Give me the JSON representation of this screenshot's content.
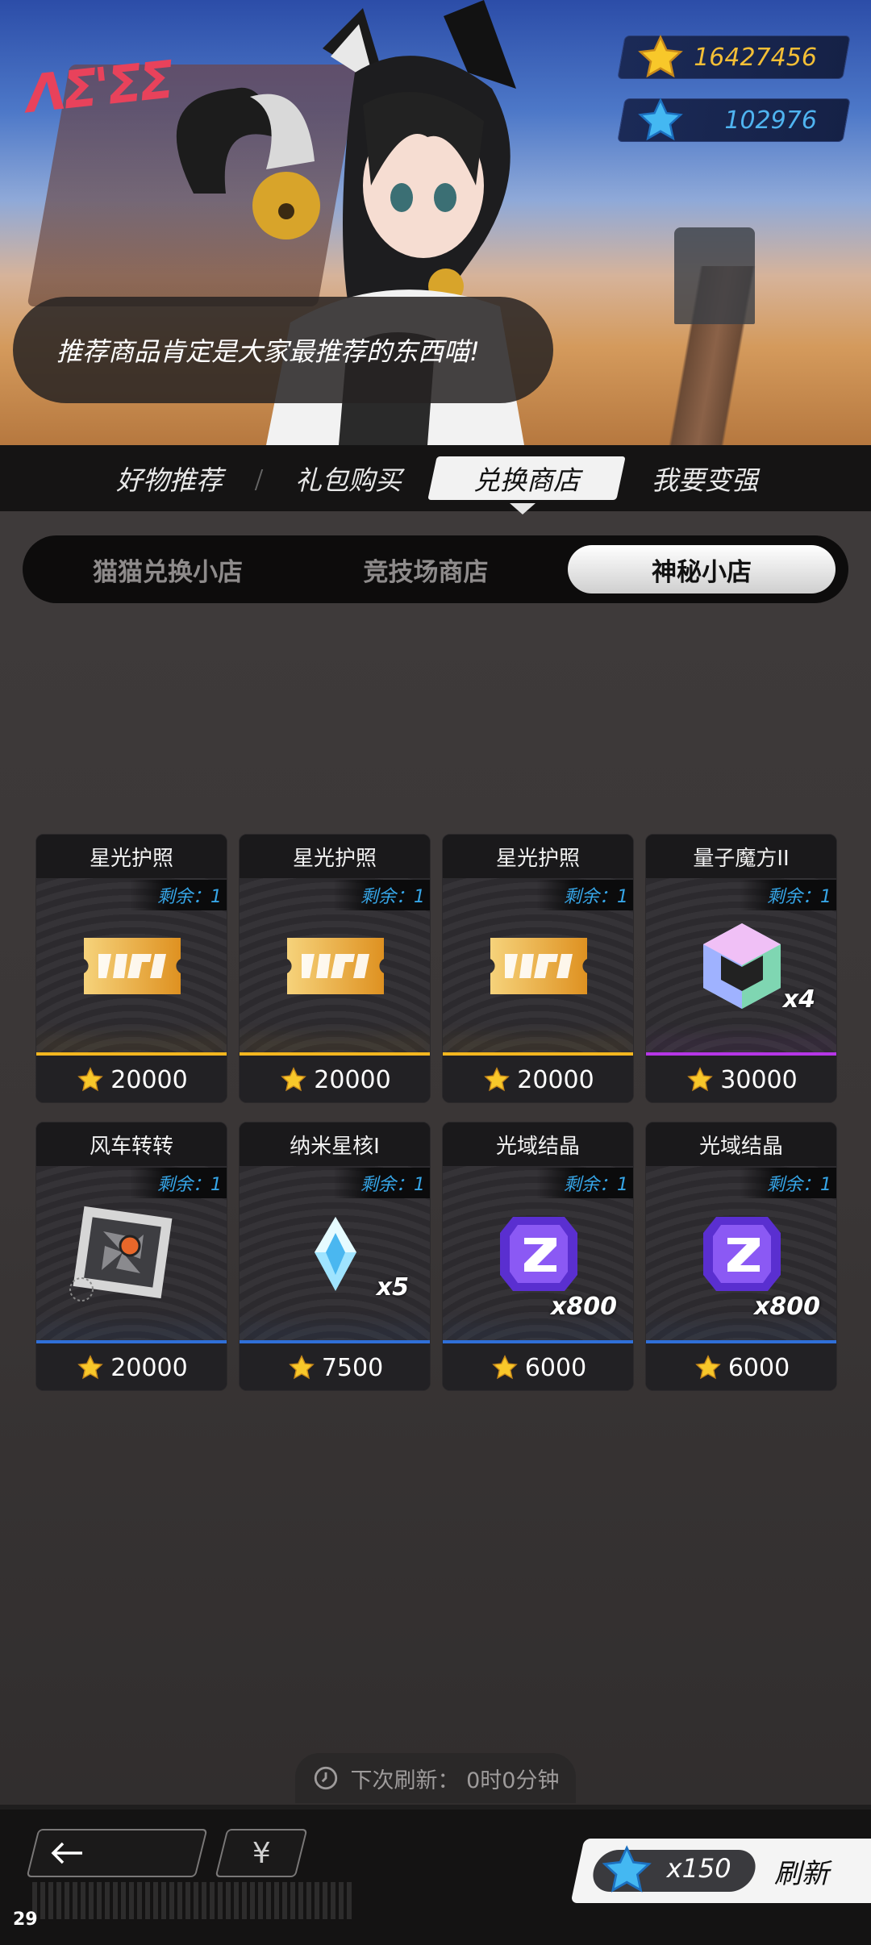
{
  "currency": {
    "gold_value": "16427456",
    "blue_value": "102976",
    "gold_icon": "gold-star-icon",
    "blue_icon": "blue-star-icon"
  },
  "speech": "推荐商品肯定是大家最推荐的东西喵!",
  "tabs": [
    {
      "label": "好物推荐",
      "active": false
    },
    {
      "label": "礼包购买",
      "active": false
    },
    {
      "label": "兑换商店",
      "active": true
    },
    {
      "label": "我要变强",
      "active": false
    }
  ],
  "subtabs": [
    {
      "label": "猫猫兑换小店",
      "active": false
    },
    {
      "label": "竞技场商店",
      "active": false
    },
    {
      "label": "神秘小店",
      "active": true
    }
  ],
  "items": [
    {
      "name": "星光护照",
      "stock": "剩余：1",
      "price": "20000",
      "rarity": "gold",
      "icon": "ticket-icon",
      "qty": ""
    },
    {
      "name": "星光护照",
      "stock": "剩余：1",
      "price": "20000",
      "rarity": "gold",
      "icon": "ticket-icon",
      "qty": ""
    },
    {
      "name": "星光护照",
      "stock": "剩余：1",
      "price": "20000",
      "rarity": "gold",
      "icon": "ticket-icon",
      "qty": ""
    },
    {
      "name": "量子魔方II",
      "stock": "剩余：1",
      "price": "30000",
      "rarity": "purple",
      "icon": "crystal-cube-icon",
      "qty": "x4"
    },
    {
      "name": "风车转转",
      "stock": "剩余：1",
      "price": "20000",
      "rarity": "blue",
      "icon": "pinwheel-frame-icon",
      "qty": ""
    },
    {
      "name": "纳米星核I",
      "stock": "剩余：1",
      "price": "7500",
      "rarity": "blue",
      "icon": "crystal-shard-icon",
      "qty": "x5"
    },
    {
      "name": "光域结晶",
      "stock": "剩余：1",
      "price": "6000",
      "rarity": "blue",
      "icon": "purple-gem-icon",
      "qty": "x800"
    },
    {
      "name": "光域结晶",
      "stock": "剩余：1",
      "price": "6000",
      "rarity": "blue",
      "icon": "purple-gem-icon",
      "qty": "x800"
    }
  ],
  "refresh_info": "下次刷新：  0时0分钟",
  "bottom": {
    "back_icon": "arrow-left-icon",
    "yen_label": "¥",
    "refresh_cost": "x150",
    "refresh_label": "刷新"
  },
  "fps": "29",
  "colors": {
    "gold": "#f3b61f",
    "purple": "#b636e6",
    "blue": "#2f6fd8",
    "accent_blue": "#36a6e8"
  }
}
